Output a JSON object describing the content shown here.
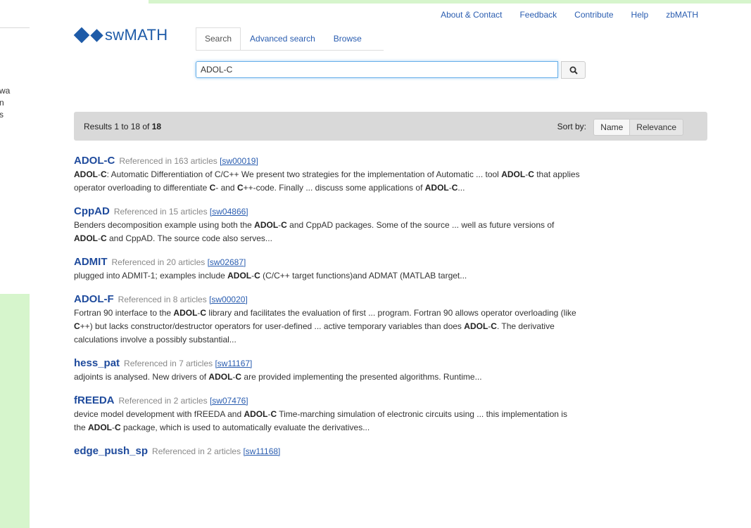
{
  "left_fragments": [
    "wa",
    "n",
    "s"
  ],
  "top_nav": [
    {
      "label": "About & Contact"
    },
    {
      "label": "Feedback"
    },
    {
      "label": "Contribute"
    },
    {
      "label": "Help"
    },
    {
      "label": "zbMATH"
    }
  ],
  "logo": {
    "text": "swMATH"
  },
  "tabs": [
    {
      "label": "Search",
      "active": true
    },
    {
      "label": "Advanced search",
      "active": false
    },
    {
      "label": "Browse",
      "active": false
    }
  ],
  "search": {
    "value": "ADOL-C",
    "button_icon": "search-icon"
  },
  "results_bar": {
    "prefix": "Results 1 to 18 of ",
    "total": "18",
    "sort_label": "Sort by:",
    "sort_options": [
      "Name",
      "Relevance"
    ]
  },
  "results": [
    {
      "title": "ADOL-C",
      "ref": "Referenced in 163 articles",
      "id": "[sw00019]",
      "snippet": [
        {
          "t": "ADOL",
          "b": true
        },
        {
          "t": "-",
          "b": false
        },
        {
          "t": "C",
          "b": true
        },
        {
          "t": ": Automatic Differentiation of C/C++ We present two strategies for the implementation of Automatic ... tool ",
          "b": false
        },
        {
          "t": "ADOL",
          "b": true
        },
        {
          "t": "-",
          "b": false
        },
        {
          "t": "C",
          "b": true
        },
        {
          "t": " that applies operator overloading to differentiate ",
          "b": false
        },
        {
          "t": "C",
          "b": true
        },
        {
          "t": "- and ",
          "b": false
        },
        {
          "t": "C",
          "b": true
        },
        {
          "t": "++-code. Finally ... discuss some applications of ",
          "b": false
        },
        {
          "t": "ADOL",
          "b": true
        },
        {
          "t": "-",
          "b": false
        },
        {
          "t": "C",
          "b": true
        },
        {
          "t": "...",
          "b": false
        }
      ]
    },
    {
      "title": "CppAD",
      "ref": "Referenced in 15 articles",
      "id": "[sw04866]",
      "snippet": [
        {
          "t": "Benders decomposition example using both the ",
          "b": false
        },
        {
          "t": "ADOL",
          "b": true
        },
        {
          "t": "-",
          "b": false
        },
        {
          "t": "C",
          "b": true
        },
        {
          "t": " and CppAD packages. Some of the source ... well as future versions of ",
          "b": false
        },
        {
          "t": "ADOL",
          "b": true
        },
        {
          "t": "-",
          "b": false
        },
        {
          "t": "C",
          "b": true
        },
        {
          "t": " and CppAD. The source code also serves...",
          "b": false
        }
      ]
    },
    {
      "title": "ADMIT",
      "ref": "Referenced in 20 articles",
      "id": "[sw02687]",
      "snippet": [
        {
          "t": "plugged into ADMIT-1; examples include ",
          "b": false
        },
        {
          "t": "ADOL",
          "b": true
        },
        {
          "t": "-",
          "b": false
        },
        {
          "t": "C",
          "b": true
        },
        {
          "t": " (C/C++ target functions)and ADMAT (MATLAB target...",
          "b": false
        }
      ]
    },
    {
      "title": "ADOL-F",
      "ref": "Referenced in 8 articles",
      "id": "[sw00020]",
      "snippet": [
        {
          "t": "Fortran 90 interface to the ",
          "b": false
        },
        {
          "t": "ADOL",
          "b": true
        },
        {
          "t": "-",
          "b": false
        },
        {
          "t": "C",
          "b": true
        },
        {
          "t": " library and facilitates the evaluation of first ... program. Fortran 90 allows operator overloading (like ",
          "b": false
        },
        {
          "t": "C",
          "b": true
        },
        {
          "t": "++) but lacks constructor/destructor operators for user-defined ... active temporary variables than does ",
          "b": false
        },
        {
          "t": "ADOL",
          "b": true
        },
        {
          "t": "-",
          "b": false
        },
        {
          "t": "C",
          "b": true
        },
        {
          "t": ". The derivative calculations involve a possibly substantial...",
          "b": false
        }
      ]
    },
    {
      "title": "hess_pat",
      "ref": "Referenced in 7 articles",
      "id": "[sw11167]",
      "snippet": [
        {
          "t": "adjoints is analysed. New drivers of ",
          "b": false
        },
        {
          "t": "ADOL",
          "b": true
        },
        {
          "t": "-",
          "b": false
        },
        {
          "t": "C",
          "b": true
        },
        {
          "t": " are provided implementing the presented algorithms. Runtime...",
          "b": false
        }
      ]
    },
    {
      "title": "fREEDA",
      "ref": "Referenced in 2 articles",
      "id": "[sw07476]",
      "snippet": [
        {
          "t": "device model development with fREEDA and ",
          "b": false
        },
        {
          "t": "ADOL",
          "b": true
        },
        {
          "t": "-",
          "b": false
        },
        {
          "t": "C",
          "b": true
        },
        {
          "t": " Time-marching simulation of electronic circuits using ... this implementation is the ",
          "b": false
        },
        {
          "t": "ADOL",
          "b": true
        },
        {
          "t": "-",
          "b": false
        },
        {
          "t": "C",
          "b": true
        },
        {
          "t": " package, which is used to automatically evaluate the derivatives...",
          "b": false
        }
      ]
    },
    {
      "title": "edge_push_sp",
      "ref": "Referenced in 2 articles",
      "id": "[sw11168]",
      "snippet": []
    }
  ]
}
